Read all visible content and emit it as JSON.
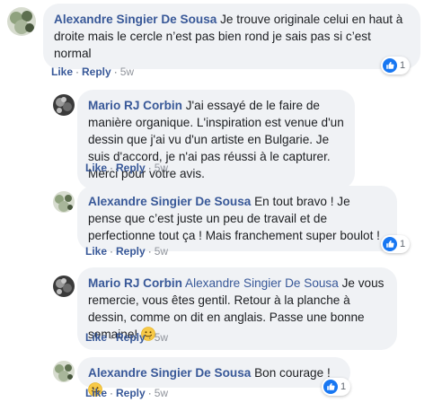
{
  "actions": {
    "like": "Like",
    "reply": "Reply",
    "separator": "·"
  },
  "comments": [
    {
      "author": "Alexandre Singier De Sousa",
      "text": " Je trouve originale celui en haut à droite mais le cercle n’est pas bien rond je sais pas si c’est normal",
      "time": "5w",
      "reactions": "1"
    },
    {
      "author": "Mario RJ Corbin",
      "text": " J'ai essayé de le faire de manière organique. L'inspiration est venue d'un dessin que j'ai vu d'un artiste en Bulgarie. Je suis d'accord, je n'ai pas réussi à le capturer. Merci pour votre avis.",
      "time": "5w"
    },
    {
      "author": "Alexandre Singier De Sousa",
      "text": " En tout bravo ! Je pense que c’est juste un peu de travail et de perfectionne tout ça ! Mais franchement super boulot !",
      "time": "5w",
      "reactions": "1"
    },
    {
      "author": "Mario RJ Corbin",
      "mention": "Alexandre Singier De Sousa",
      "text": " Je vous remercie, vous êtes gentil. Retour à la planche à dessin, comme on dit en anglais. Passe une bonne semaine!",
      "time": "5w"
    },
    {
      "author": "Alexandre Singier De Sousa",
      "text": " Bon courage !",
      "time": "5w",
      "reactions": "1"
    }
  ]
}
